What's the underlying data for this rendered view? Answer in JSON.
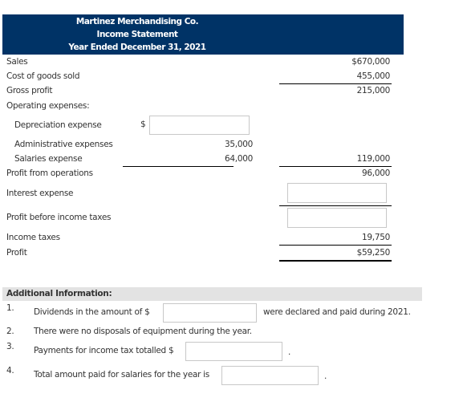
{
  "header": {
    "company": "Martinez Merchandising Co.",
    "statement": "Income Statement",
    "period": "Year Ended December 31, 2021",
    "bg_color": "#003366"
  },
  "statement": {
    "sales": {
      "label": "Sales",
      "value": "$670,000"
    },
    "cogs": {
      "label": "Cost of goods sold",
      "value": "455,000"
    },
    "gross_profit": {
      "label": "Gross profit",
      "value": "215,000"
    },
    "operating_expenses": {
      "label": "Operating expenses:"
    },
    "depreciation": {
      "label": "Depreciation expense",
      "currency": "$",
      "value": ""
    },
    "administrative": {
      "label": "Administrative expenses",
      "value": "35,000"
    },
    "salaries": {
      "label": "Salaries expense",
      "value": "64,000"
    },
    "total_operating": {
      "value": "119,000"
    },
    "profit_from_operations": {
      "label": "Profit from operations",
      "value": "96,000"
    },
    "interest_expense": {
      "label": "Interest expense",
      "value": ""
    },
    "profit_before_taxes": {
      "label": "Profit before income taxes",
      "value": ""
    },
    "income_taxes": {
      "label": "Income taxes",
      "value": "19,750"
    },
    "profit": {
      "label": "Profit",
      "value": "$59,250"
    }
  },
  "additional": {
    "title": "Additional Information:",
    "items": [
      {
        "num": "1.",
        "text_before": "Dividends in the amount of $",
        "value": "",
        "text_after": "were declared and paid during 2021."
      },
      {
        "num": "2.",
        "text": "There were no disposals of equipment during the year."
      },
      {
        "num": "3.",
        "text_before": "Payments for income tax totalled $",
        "value": "",
        "text_after": "."
      },
      {
        "num": "4.",
        "text_before": "Total amount paid for salaries for the year is",
        "value": "",
        "text_after": "."
      }
    ]
  }
}
